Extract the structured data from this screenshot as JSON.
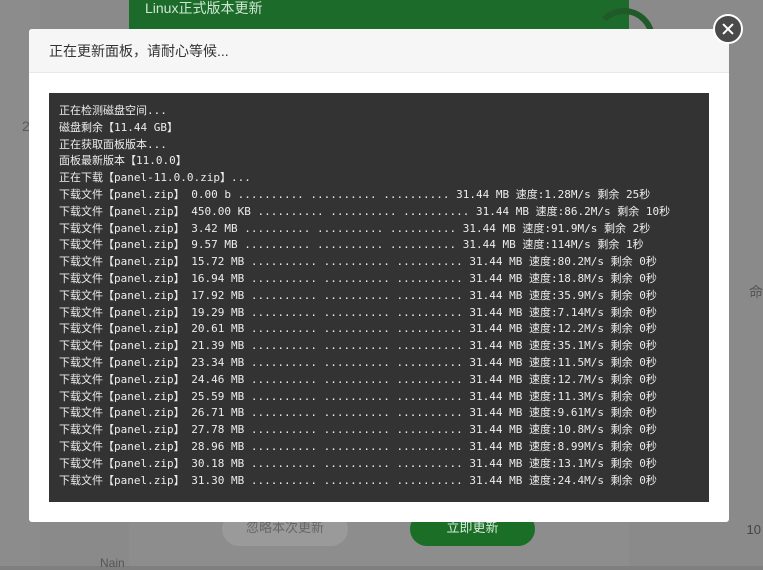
{
  "background": {
    "panel_title": "Linux正式版本更新",
    "left_number": "2",
    "right_number": "10",
    "right_glyph": "命",
    "ignore_button": "忽略本次更新",
    "update_button": "立即更新",
    "bottom_text": "Nain"
  },
  "modal": {
    "title": "正在更新面板，请耐心等候...",
    "close_icon": "close-icon",
    "log_lines": [
      "正在检测磁盘空间...",
      "磁盘剩余【11.44 GB】",
      "正在获取面板版本...",
      "面板最新版本【11.0.0】",
      "正在下载【panel-11.0.0.zip】...",
      "下载文件【panel.zip】 0.00 b .......... .......... .......... 31.44 MB 速度:1.28M/s 剩余 25秒",
      "下载文件【panel.zip】 450.00 KB .......... .......... .......... 31.44 MB 速度:86.2M/s 剩余 10秒",
      "下载文件【panel.zip】 3.42 MB .......... .......... .......... 31.44 MB 速度:91.9M/s 剩余 2秒",
      "下载文件【panel.zip】 9.57 MB .......... .......... .......... 31.44 MB 速度:114M/s 剩余 1秒",
      "下载文件【panel.zip】 15.72 MB .......... .......... .......... 31.44 MB 速度:80.2M/s 剩余 0秒",
      "下载文件【panel.zip】 16.94 MB .......... .......... .......... 31.44 MB 速度:18.8M/s 剩余 0秒",
      "下载文件【panel.zip】 17.92 MB .......... .......... .......... 31.44 MB 速度:35.9M/s 剩余 0秒",
      "下载文件【panel.zip】 19.29 MB .......... .......... .......... 31.44 MB 速度:7.14M/s 剩余 0秒",
      "下载文件【panel.zip】 20.61 MB .......... .......... .......... 31.44 MB 速度:12.2M/s 剩余 0秒",
      "下载文件【panel.zip】 21.39 MB .......... .......... .......... 31.44 MB 速度:35.1M/s 剩余 0秒",
      "下载文件【panel.zip】 23.34 MB .......... .......... .......... 31.44 MB 速度:11.5M/s 剩余 0秒",
      "下载文件【panel.zip】 24.46 MB .......... .......... .......... 31.44 MB 速度:12.7M/s 剩余 0秒",
      "下载文件【panel.zip】 25.59 MB .......... .......... .......... 31.44 MB 速度:11.3M/s 剩余 0秒",
      "下载文件【panel.zip】 26.71 MB .......... .......... .......... 31.44 MB 速度:9.61M/s 剩余 0秒",
      "下载文件【panel.zip】 27.78 MB .......... .......... .......... 31.44 MB 速度:10.8M/s 剩余 0秒",
      "下载文件【panel.zip】 28.96 MB .......... .......... .......... 31.44 MB 速度:8.99M/s 剩余 0秒",
      "下载文件【panel.zip】 30.18 MB .......... .......... .......... 31.44 MB 速度:13.1M/s 剩余 0秒",
      "下载文件【panel.zip】 31.30 MB .......... .......... .......... 31.44 MB 速度:24.4M/s 剩余 0秒"
    ]
  }
}
